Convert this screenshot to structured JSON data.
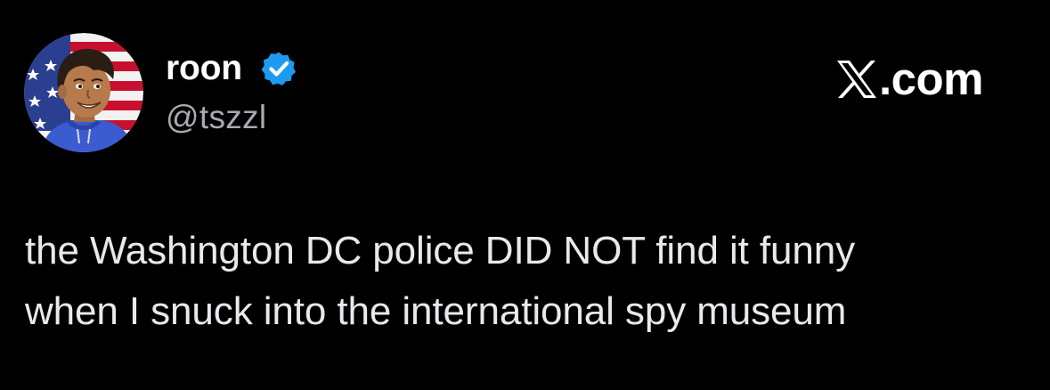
{
  "author": {
    "display_name": "roon",
    "handle": "@tszzl",
    "verified": true,
    "avatar_description": "cartoon boy with flag background"
  },
  "brand": {
    "domain_suffix": ".com",
    "logo_icon": "x-logo-icon"
  },
  "tweet": {
    "lines": [
      "the Washington DC police DID NOT find it funny",
      "when I snuck into the international spy museum"
    ]
  },
  "colors": {
    "background": "#000000",
    "name": "#ffffff",
    "handle": "#a7abb0",
    "text": "#e7e9ea",
    "verified": "#1d9bf0"
  }
}
